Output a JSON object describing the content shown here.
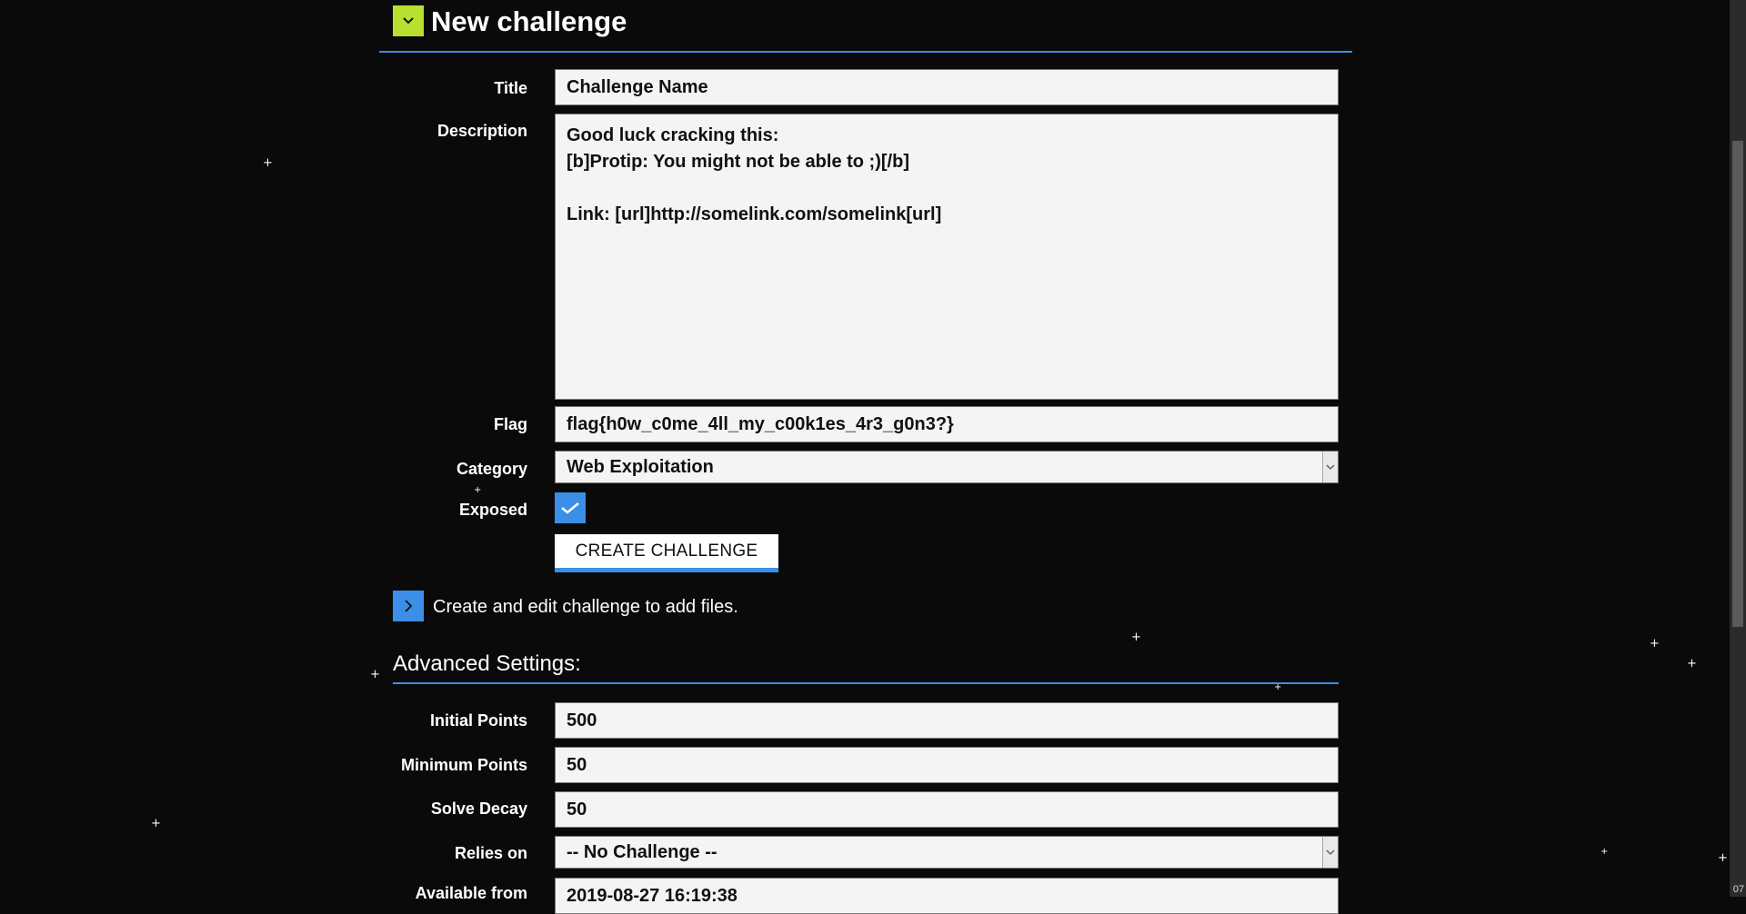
{
  "header": {
    "title": "New challenge"
  },
  "form": {
    "title_label": "Title",
    "title_value": "Challenge Name",
    "description_label": "Description",
    "description_value": "Good luck cracking this:\n[b]Protip: You might not be able to ;)[/b]\n\nLink: [url]http://somelink.com/somelink[url]",
    "flag_label": "Flag",
    "flag_value": "flag{h0w_c0me_4ll_my_c00k1es_4r3_g0n3?}",
    "category_label": "Category",
    "category_value": "Web Exploitation",
    "exposed_label": "Exposed",
    "exposed_checked": true,
    "create_button": "CREATE CHALLENGE"
  },
  "files_note": "Create and edit challenge to add files.",
  "advanced": {
    "title": "Advanced Settings:",
    "initial_points_label": "Initial Points",
    "initial_points_value": "500",
    "minimum_points_label": "Minimum Points",
    "minimum_points_value": "50",
    "solve_decay_label": "Solve Decay",
    "solve_decay_value": "50",
    "relies_on_label": "Relies on",
    "relies_on_value": "-- No Challenge --",
    "available_from_label": "Available from",
    "available_from_value": "2019-08-27 16:19:38"
  },
  "corner_text": "07",
  "colors": {
    "accent": "#3c8fe6",
    "toggle_green": "#b7e12e",
    "background": "#0a0a0a"
  },
  "icons": [
    "chevron-down-icon",
    "chevron-right-icon",
    "checkmark-icon",
    "select-arrow-icon"
  ]
}
